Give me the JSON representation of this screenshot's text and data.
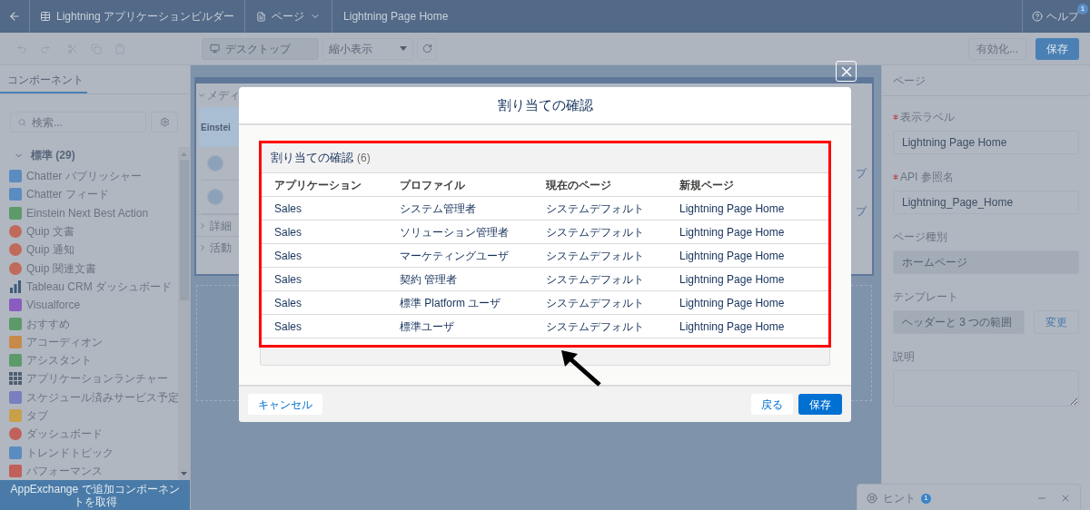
{
  "top_bar": {
    "app_title": "Lightning アプリケーションビルダー",
    "page_menu": "ページ",
    "page_name": "Lightning Page Home",
    "help": "ヘルプ",
    "help_badge": "1"
  },
  "toolbar": {
    "device": "デスクトップ",
    "zoom": "縮小表示",
    "activate": "有効化...",
    "save": "保存"
  },
  "sidebar": {
    "tab": "コンポーネント",
    "search_placeholder": "検索...",
    "section": {
      "label": "標準 (29)",
      "expanded": true
    },
    "items": [
      {
        "label": "Chatter パブリッシャー",
        "kind": "tile",
        "color": "#5b8cbf"
      },
      {
        "label": "Chatter フィード",
        "kind": "tile",
        "color": "#5b8cbf"
      },
      {
        "label": "Einstein Next Best Action",
        "kind": "tile",
        "color": "#5d9a6a"
      },
      {
        "label": "Quip 文書",
        "kind": "round",
        "color": "#c06a5c"
      },
      {
        "label": "Quip 通知",
        "kind": "round",
        "color": "#c06a5c"
      },
      {
        "label": "Quip 関連文書",
        "kind": "round",
        "color": "#c06a5c"
      },
      {
        "label": "Tableau CRM ダッシュボード",
        "kind": "chart",
        "color": "#3e5a7a"
      },
      {
        "label": "Visualforce",
        "kind": "tile",
        "color": "#8a5cc0"
      },
      {
        "label": "おすすめ",
        "kind": "tile",
        "color": "#5d9a6a"
      },
      {
        "label": "アコーディオン",
        "kind": "tile",
        "color": "#c88a4a"
      },
      {
        "label": "アシスタント",
        "kind": "tile",
        "color": "#5d9a6a"
      },
      {
        "label": "アプリケーションランチャー",
        "kind": "grid",
        "color": "#4f5d70"
      },
      {
        "label": "スケジュール済みサービス予定",
        "kind": "tile",
        "color": "#7a7fc0"
      },
      {
        "label": "タブ",
        "kind": "tile",
        "color": "#c8a04a"
      },
      {
        "label": "ダッシュボード",
        "kind": "round",
        "color": "#c0605a"
      },
      {
        "label": "トレンドトピック",
        "kind": "tile",
        "color": "#5b8cbf"
      },
      {
        "label": "パフォーマンス",
        "kind": "tile",
        "color": "#c0605a"
      }
    ],
    "footer": "AppExchange で追加コンポーネントを取得"
  },
  "canvas": {
    "section": "メディ",
    "column": "Einstei",
    "collapsed_sections": [
      "詳細",
      "活動"
    ],
    "right_fragments": [
      "プ",
      "プ"
    ]
  },
  "modal": {
    "title": "割り当ての確認",
    "card_title": "割り当ての確認",
    "count": "(6)",
    "columns": [
      "アプリケーション",
      "プロファイル",
      "現在のページ",
      "新規ページ"
    ],
    "rows": [
      [
        "Sales",
        "システム管理者",
        "システムデフォルト",
        "Lightning Page Home"
      ],
      [
        "Sales",
        "ソリューション管理者",
        "システムデフォルト",
        "Lightning Page Home"
      ],
      [
        "Sales",
        "マーケティングユーザ",
        "システムデフォルト",
        "Lightning Page Home"
      ],
      [
        "Sales",
        "契約 管理者",
        "システムデフォルト",
        "Lightning Page Home"
      ],
      [
        "Sales",
        "標準 Platform ユーザ",
        "システムデフォルト",
        "Lightning Page Home"
      ],
      [
        "Sales",
        "標準ユーザ",
        "システムデフォルト",
        "Lightning Page Home"
      ]
    ],
    "cancel": "キャンセル",
    "back": "戻る",
    "save": "保存"
  },
  "properties": {
    "header": "ページ",
    "fields": [
      {
        "kind": "input",
        "label": "表示ラベル",
        "value": "Lightning Page Home",
        "required": true,
        "disabled": false
      },
      {
        "kind": "input",
        "label": "API 参照名",
        "value": "Lightning_Page_Home",
        "required": true,
        "disabled": false
      },
      {
        "kind": "input",
        "label": "ページ種別",
        "value": "ホームページ",
        "required": false,
        "disabled": true
      },
      {
        "kind": "input_button",
        "label": "テンプレート",
        "value": "ヘッダーと 3 つの範囲",
        "required": false,
        "disabled": true,
        "button": "変更"
      },
      {
        "kind": "textarea",
        "label": "説明",
        "required": false,
        "disabled": false
      }
    ]
  },
  "hint": {
    "label": "ヒント",
    "badge": "1"
  }
}
